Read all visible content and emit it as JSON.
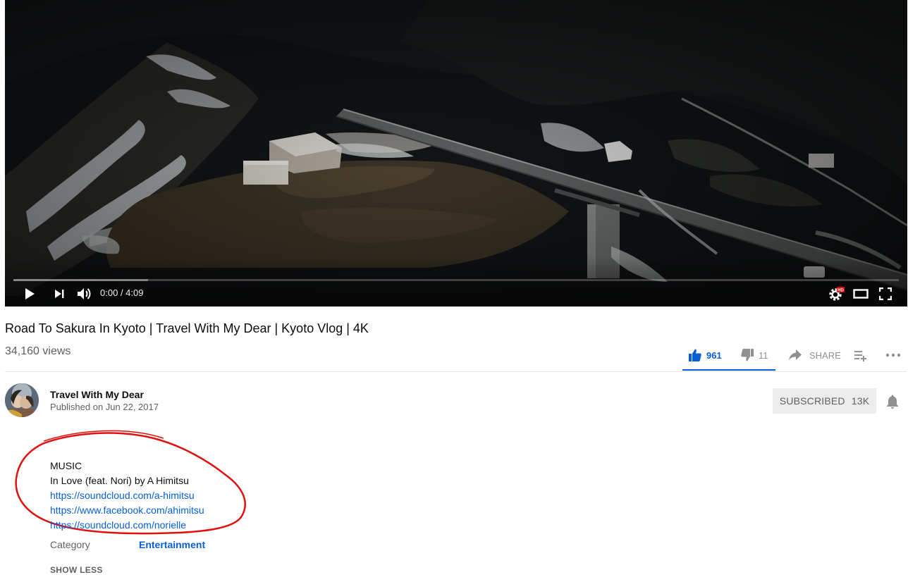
{
  "player": {
    "current_time": "0:00",
    "duration": "4:09",
    "played_fraction": 0.0,
    "buffered_fraction": 0.152,
    "controls": [
      "play-icon",
      "next-icon",
      "volume-icon",
      "settings-icon",
      "hd-badge",
      "theater-icon",
      "fullscreen-icon"
    ],
    "hd_label": "HD"
  },
  "video": {
    "title": "Road To Sakura In Kyoto | Travel With My Dear | Kyoto Vlog | 4K",
    "views": "34,160 views"
  },
  "actions": {
    "likes": "961",
    "dislikes": "11",
    "share_label": "SHARE",
    "icons": [
      "thumbs-up-icon",
      "thumbs-down-icon",
      "share-icon",
      "add-to-playlist-icon",
      "more-icon"
    ]
  },
  "owner": {
    "channel_name": "Travel With My Dear",
    "published": "Published on Jun 22, 2017",
    "subscribe_label": "SUBSCRIBED",
    "subscriber_count": "13K"
  },
  "description": {
    "heading": "MUSIC",
    "song": "In Love (feat. Nori) by A Himitsu",
    "links": [
      "https://soundcloud.com/a-himitsu",
      "https://www.facebook.com/ahimitsu",
      "https://soundcloud.com/norielle"
    ]
  },
  "metadata": {
    "category_label": "Category",
    "category_value": "Entertainment",
    "show_less_label": "SHOW LESS"
  },
  "colors": {
    "accent_blue": "#065fd4",
    "progress_red": "#ff0000",
    "annotation_red": "#e01010"
  }
}
